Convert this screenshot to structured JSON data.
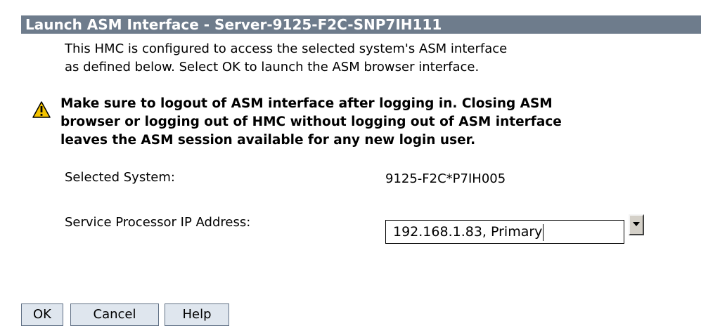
{
  "dialog": {
    "title": "Launch ASM Interface - Server-9125-F2C-SNP7IH111",
    "intro_line_1": "This HMC is configured to access the selected system's ASM interface",
    "intro_line_2": "as defined below. Select OK to launch the ASM browser interface.",
    "warning_line_1": "Make sure to logout of ASM interface after logging in. Closing ASM",
    "warning_line_2": "browser or logging out of HMC without logging out of ASM interface",
    "warning_line_3": "leaves the ASM session available for any new login user.",
    "warning_icon": "warning-triangle-icon"
  },
  "fields": {
    "selected_system_label": "Selected System:",
    "selected_system_value": "9125-F2C*P7IH005",
    "sp_ip_label": "Service Processor IP Address:",
    "sp_ip_value": "192.168.1.83, Primary"
  },
  "buttons": {
    "ok": "OK",
    "cancel": "Cancel",
    "help": "Help"
  },
  "colors": {
    "title_bar": "#6e7c8c",
    "warning_yellow": "#f5c400",
    "button_bg": "#dfe6ee"
  }
}
